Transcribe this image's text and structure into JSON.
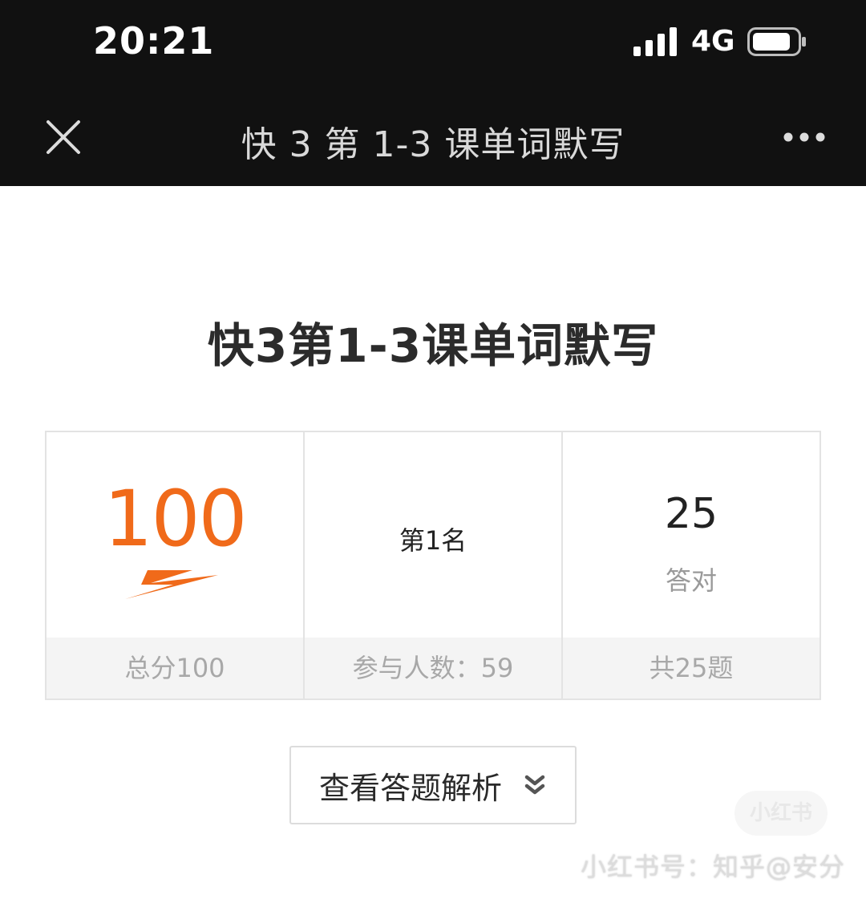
{
  "status_bar": {
    "time": "20:21",
    "network": "4G",
    "signal_icon": "signal-bars-icon",
    "battery_icon": "battery-icon"
  },
  "nav": {
    "title": "快 3 第 1-3 课单词默写",
    "close_icon": "close-icon",
    "more_icon": "more-icon"
  },
  "page": {
    "title": "快3第1-3课单词默写"
  },
  "stats": {
    "score": "100",
    "total_score_label": "总分100",
    "rank": "第1名",
    "participants_label": "参与人数：59",
    "correct_count": "25",
    "correct_label": "答对",
    "total_questions_label": "共25题"
  },
  "actions": {
    "view_analysis": "查看答题解析",
    "chevron_icon": "chevron-double-down-icon"
  },
  "watermark": {
    "badge": "小红书",
    "text": "小红书号：知乎@安分"
  },
  "colors": {
    "accent": "#f06a1a",
    "header_bg": "#111111"
  }
}
